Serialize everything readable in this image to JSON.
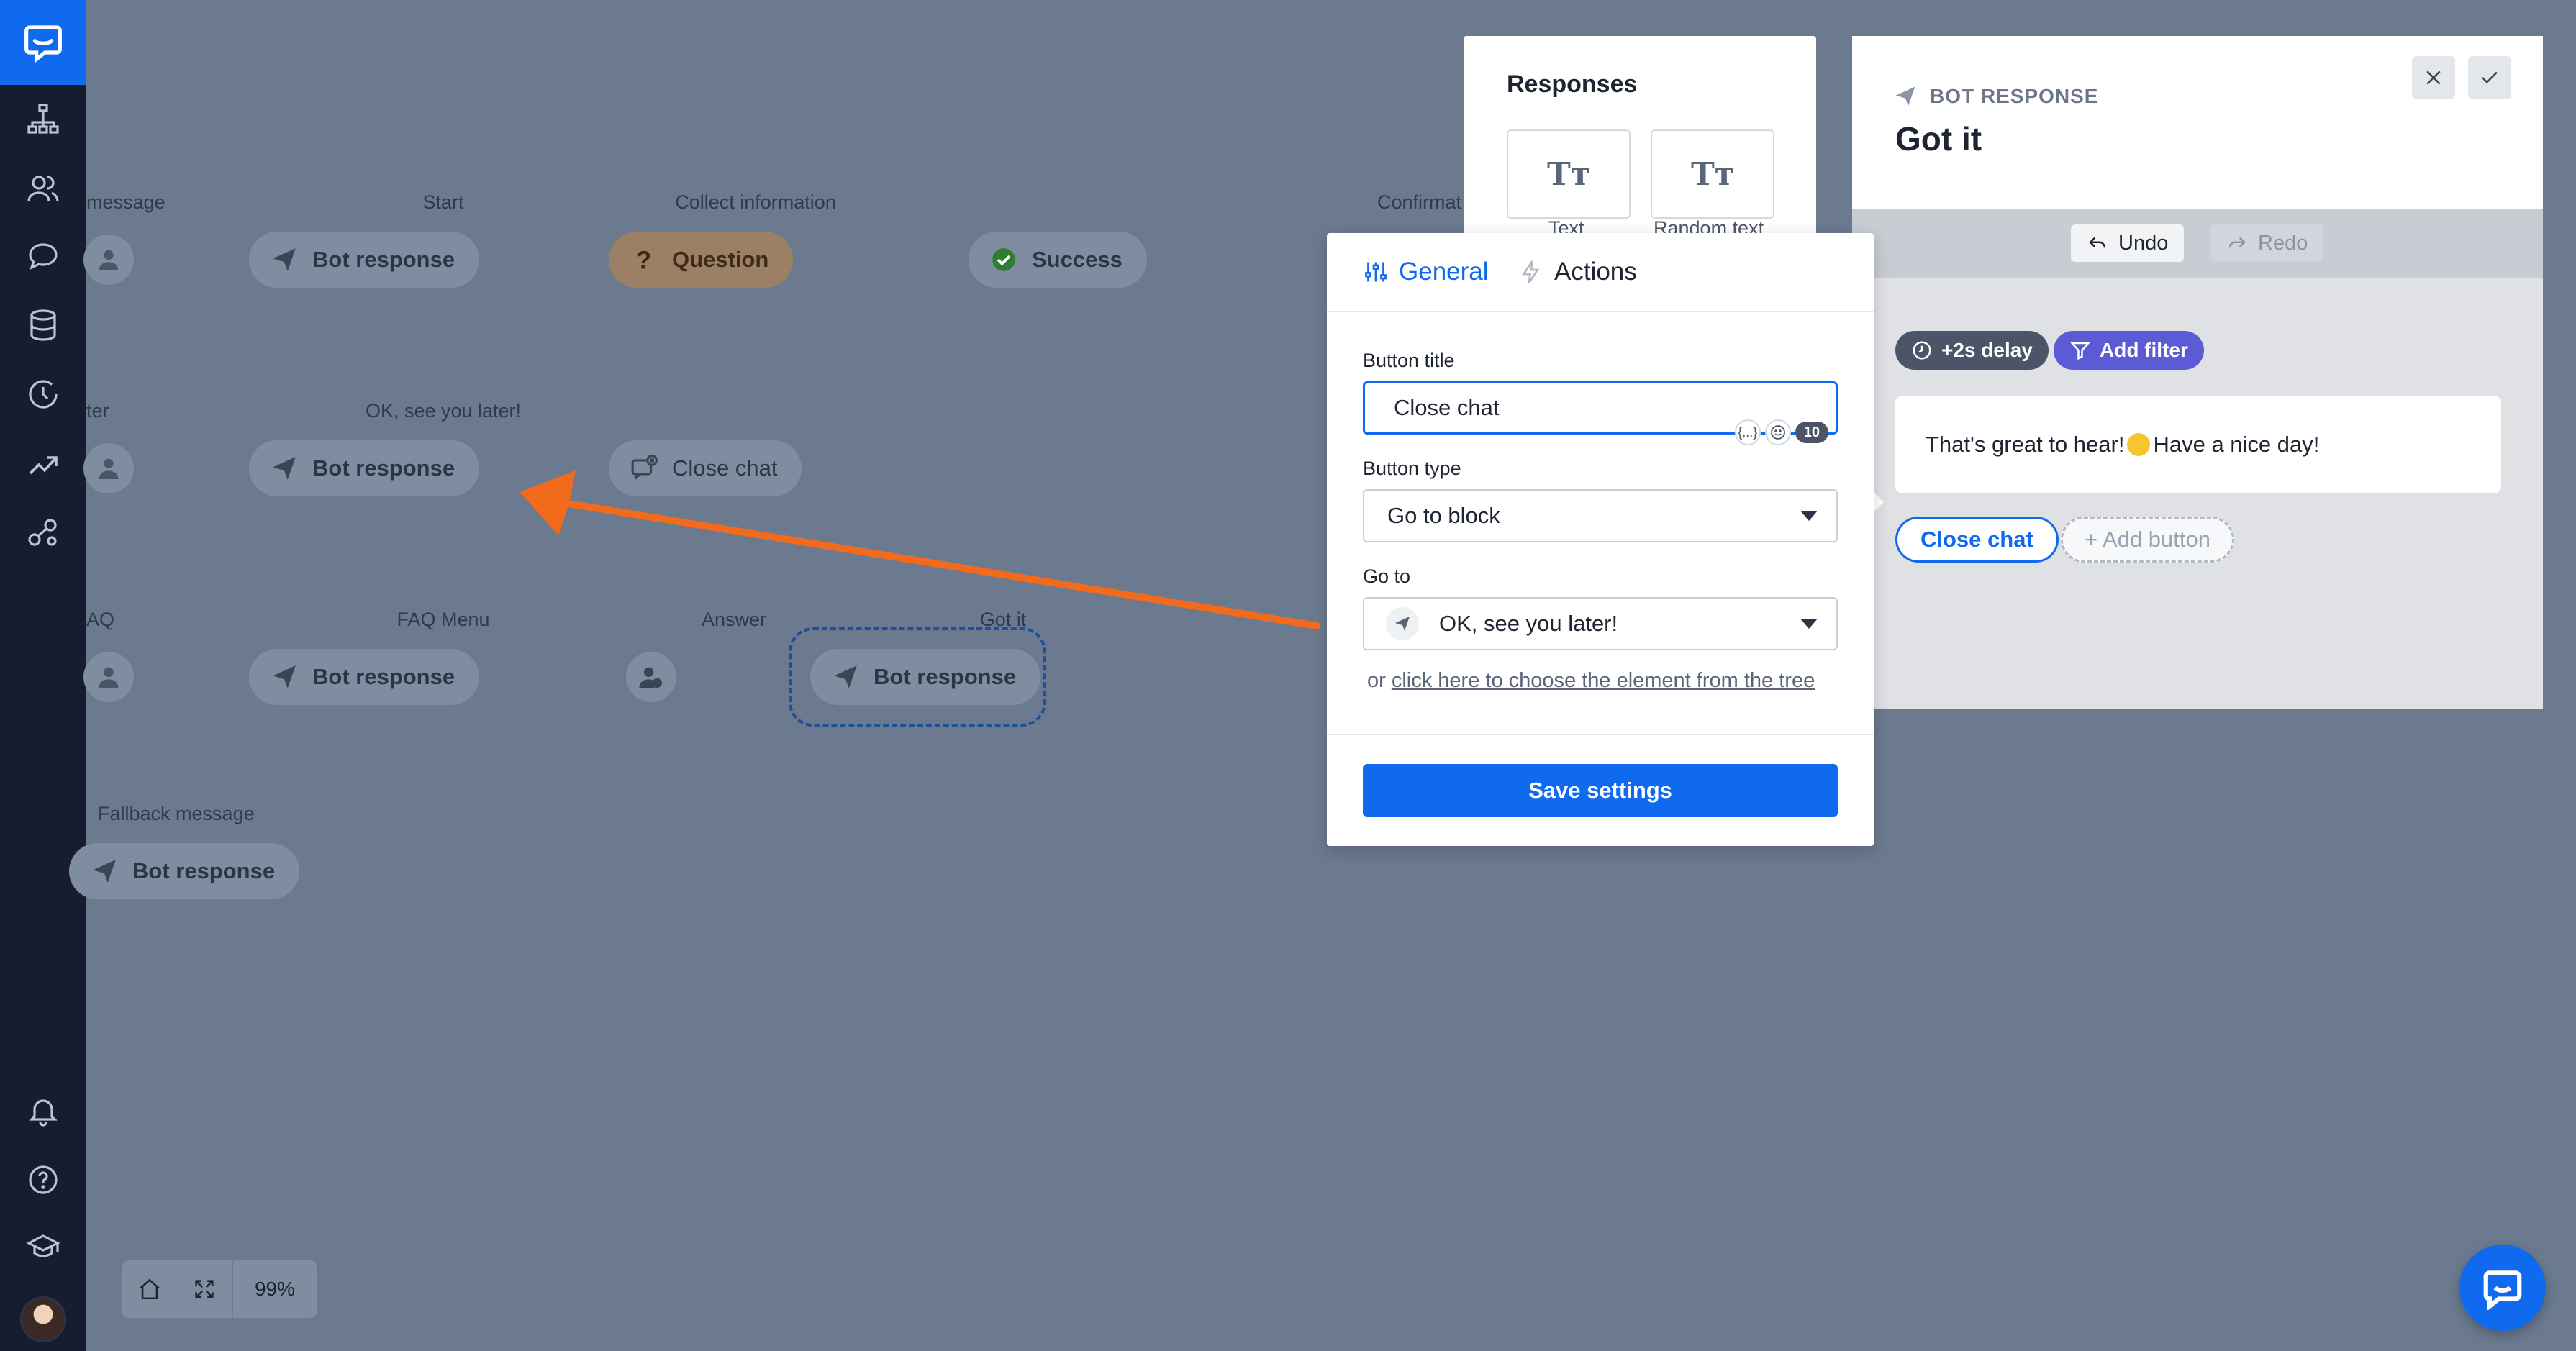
{
  "sidebar": {
    "items": [
      {
        "icon": "chatbot-logo-icon"
      },
      {
        "icon": "stories-tree-icon"
      },
      {
        "icon": "users-icon"
      },
      {
        "icon": "chat-bubble-icon"
      },
      {
        "icon": "database-icon"
      },
      {
        "icon": "history-icon"
      },
      {
        "icon": "analytics-icon"
      },
      {
        "icon": "integrations-icon"
      },
      {
        "icon": "bell-icon"
      },
      {
        "icon": "help-icon"
      },
      {
        "icon": "academy-icon"
      }
    ]
  },
  "canvas": {
    "rows": [
      {
        "labels": [
          "message",
          "Start",
          "Collect information",
          "Confirmat"
        ],
        "nodes": [
          "Bot response",
          "Question",
          "Success"
        ]
      },
      {
        "labels": [
          "ter",
          "OK, see you later!"
        ],
        "nodes": [
          "Bot response",
          "Close chat"
        ]
      },
      {
        "labels": [
          "AQ",
          "FAQ Menu",
          "Answer",
          "Got it"
        ],
        "nodes": [
          "Bot response",
          "Bot response"
        ]
      },
      {
        "labels": [
          "Fallback message"
        ],
        "nodes": [
          "Bot response"
        ]
      }
    ],
    "zoom": "99%"
  },
  "responses": {
    "title": "Responses",
    "cards": [
      {
        "glyph": "Tт",
        "caption": "Text"
      },
      {
        "glyph": "Tт",
        "caption": "Random text"
      }
    ]
  },
  "bot_panel": {
    "kicker": "BOT RESPONSE",
    "title": "Got it",
    "undo": "Undo",
    "redo": "Redo",
    "delay": "+2s delay",
    "filter": "Add filter",
    "message": "That's great to hear!",
    "message_after_emoji": " Have a nice day!",
    "button": "Close chat",
    "add_button": "+ Add button"
  },
  "popup": {
    "tab_general": "General",
    "tab_actions": "Actions",
    "button_title_label": "Button title",
    "button_title_value": "Close chat",
    "token_chip": "{...}",
    "char_count": "10",
    "button_type_label": "Button type",
    "button_type_value": "Go to block",
    "goto_label": "Go to",
    "goto_value": "OK, see you later!",
    "tree_prefix": "or ",
    "tree_link": "click here to choose the element from the tree",
    "save": "Save settings"
  },
  "colors": {
    "accent": "#0f6af0",
    "sidebar": "#151d2e",
    "canvas": "#6b7a8f",
    "annotation_arrow": "#f26b1d",
    "delay_tag": "#4b5567",
    "filter_tag": "#5b5bd6"
  }
}
